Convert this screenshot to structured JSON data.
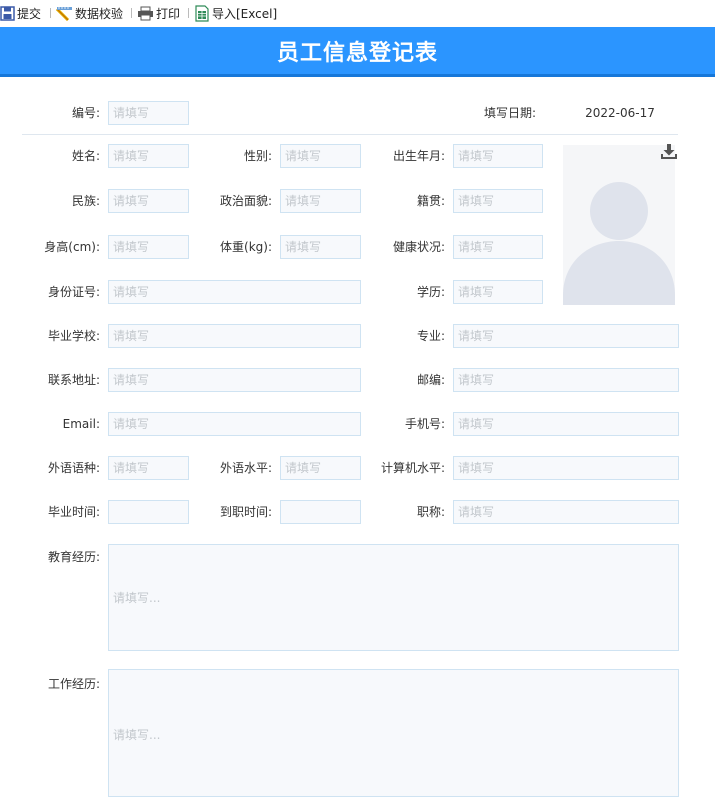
{
  "toolbar": {
    "submit_label": "提交",
    "validate_label": "数据校验",
    "print_label": "打印",
    "import_label": "导入[Excel]"
  },
  "form": {
    "title": "员工信息登记表",
    "placeholder": "请填写",
    "placeholder_long": "请填写...",
    "date_label": "填写日期:",
    "date_value": "2022-06-17",
    "labels": {
      "number": "编号:",
      "name": "姓名:",
      "gender": "性别:",
      "birth": "出生年月:",
      "ethnicity": "民族:",
      "politics": "政治面貌:",
      "native": "籍贯:",
      "height": "身高(cm):",
      "weight": "体重(kg):",
      "health": "健康状况:",
      "id_number": "身份证号:",
      "education": "学历:",
      "school": "毕业学校:",
      "major": "专业:",
      "address": "联系地址:",
      "postcode": "邮编:",
      "email": "Email:",
      "phone": "手机号:",
      "language": "外语语种:",
      "language_level": "外语水平:",
      "computer_level": "计算机水平:",
      "grad_time": "毕业时间:",
      "join_time": "到职时间:",
      "job_title": "职称:",
      "edu_history": "教育经历:",
      "work_history": "工作经历:"
    }
  },
  "icons": {
    "submit": "save-icon",
    "validate": "pencil-ruler-icon",
    "print": "printer-icon",
    "import": "excel-icon",
    "download": "download-icon",
    "avatar": "avatar-placeholder-icon"
  },
  "colors": {
    "header_bg": "#2b95ff",
    "header_border": "#1677d9",
    "input_border": "#cfe3f2",
    "input_bg": "#f7f9fc"
  }
}
